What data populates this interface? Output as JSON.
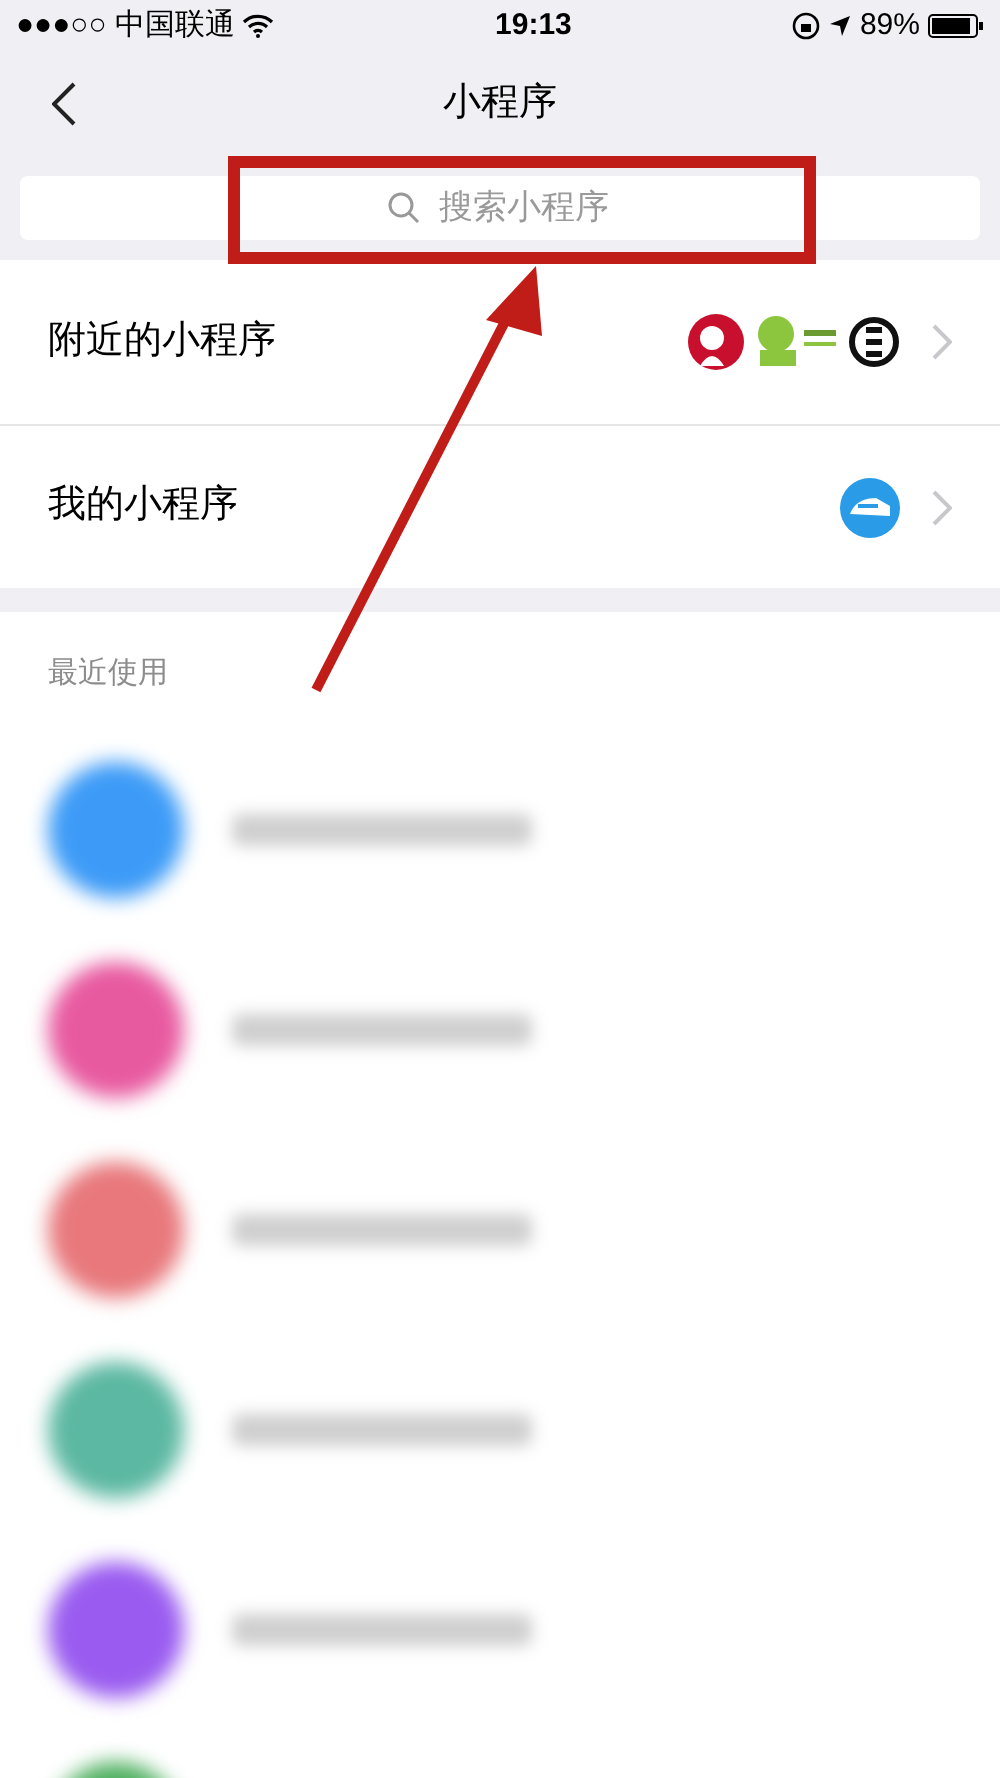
{
  "status_bar": {
    "carrier": "●●●○○ 中国联通",
    "time": "19:13",
    "battery": "89%"
  },
  "nav": {
    "title": "小程序"
  },
  "search": {
    "placeholder": "搜索小程序"
  },
  "entries": [
    {
      "kind": "nearby",
      "label": "附近的小程序"
    },
    {
      "kind": "mine",
      "label": "我的小程序"
    }
  ],
  "recent": {
    "heading": "最近使用",
    "items": [
      {
        "color": "#3d9bf7"
      },
      {
        "color": "#e85aa0"
      },
      {
        "color": "#e8787c"
      },
      {
        "color": "#5cb8a2"
      },
      {
        "color": "#9a5cf0"
      },
      {
        "color": "#4fb060"
      }
    ]
  }
}
